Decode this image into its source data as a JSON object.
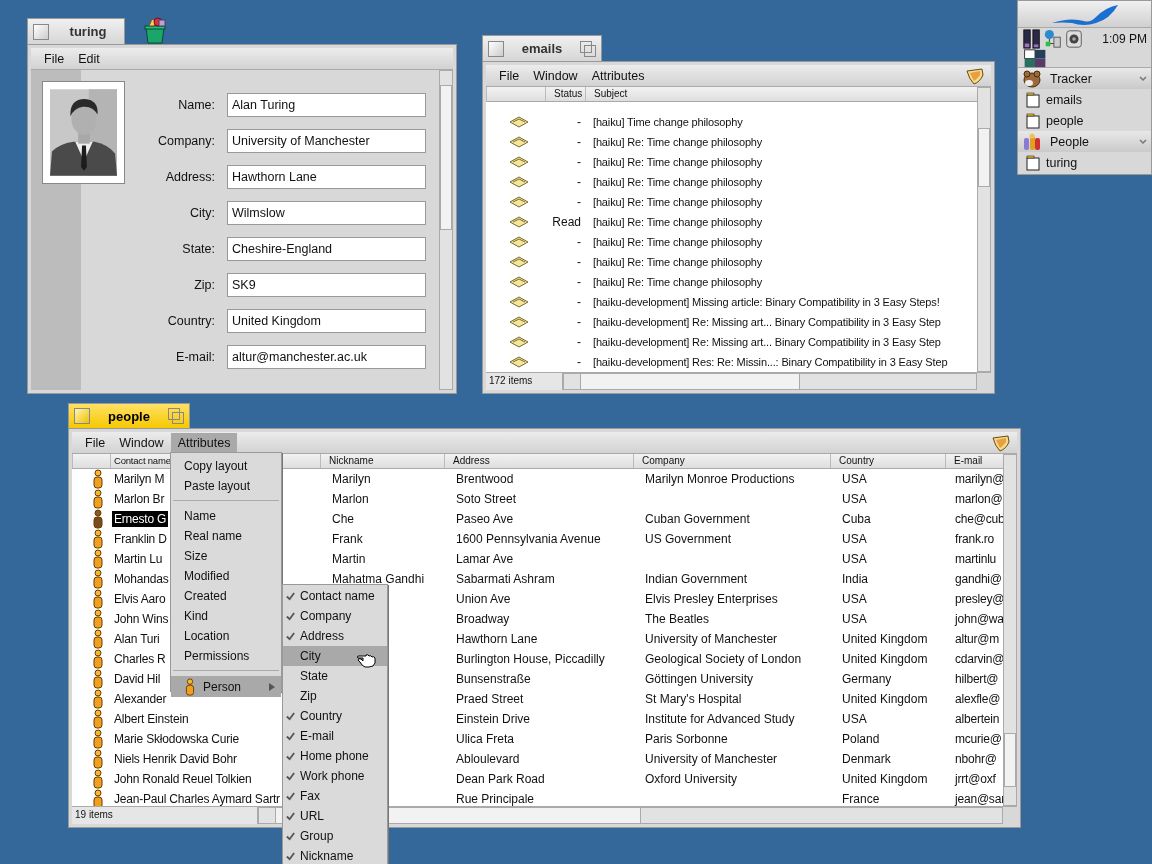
{
  "turing_window": {
    "title": "turing",
    "active": false,
    "menu": [
      "File",
      "Edit"
    ],
    "fields": [
      {
        "label": "Name:",
        "value": "Alan Turing"
      },
      {
        "label": "Company:",
        "value": "University of Manchester"
      },
      {
        "label": "Address:",
        "value": "Hawthorn Lane"
      },
      {
        "label": "City:",
        "value": "Wilmslow"
      },
      {
        "label": "State:",
        "value": "Cheshire-England"
      },
      {
        "label": "Zip:",
        "value": "SK9"
      },
      {
        "label": "Country:",
        "value": "United Kingdom"
      },
      {
        "label": "E-mail:",
        "value": "altur@manchester.ac.uk"
      }
    ]
  },
  "emails_window": {
    "title": "emails",
    "active": false,
    "menu": [
      "File",
      "Window",
      "Attributes"
    ],
    "columns": [
      "Status",
      "Subject"
    ],
    "rows": [
      {
        "status": "-",
        "subject": "[haiku] Time change philosophy"
      },
      {
        "status": "-",
        "subject": "[haiku] Re: Time change philosophy"
      },
      {
        "status": "-",
        "subject": "[haiku] Re: Time change philosophy"
      },
      {
        "status": "-",
        "subject": "[haiku] Re: Time change philosophy"
      },
      {
        "status": "-",
        "subject": "[haiku] Re: Time change philosophy"
      },
      {
        "status": "Read",
        "subject": "[haiku] Re: Time change philosophy"
      },
      {
        "status": "-",
        "subject": "[haiku] Re: Time change philosophy"
      },
      {
        "status": "-",
        "subject": "[haiku] Re: Time change philosophy"
      },
      {
        "status": "-",
        "subject": "[haiku] Re: Time change philosophy"
      },
      {
        "status": "-",
        "subject": "[haiku-development] Missing article: Binary Compatibility in 3 Easy Steps!"
      },
      {
        "status": "-",
        "subject": "[haiku-development] Re: Missing art... Binary Compatibility in 3 Easy Step"
      },
      {
        "status": "-",
        "subject": "[haiku-development] Re: Missing art... Binary Compatibility in 3 Easy Step"
      },
      {
        "status": "-",
        "subject": "[haiku-development] Res: Re: Missin...: Binary Compatibility in 3 Easy Step"
      }
    ],
    "status": "172 items"
  },
  "people_window": {
    "title": "people",
    "active": true,
    "menu": [
      {
        "label": "File",
        "selected": false
      },
      {
        "label": "Window",
        "selected": false
      },
      {
        "label": "Attributes",
        "selected": true
      }
    ],
    "columns": [
      "Contact name",
      "Nickname",
      "Address",
      "Company",
      "Country",
      "E-mail"
    ],
    "rows": [
      {
        "name": "Marilyn M",
        "nickname": "Marilyn",
        "address": "Brentwood",
        "company": "Marilyn Monroe Productions",
        "country": "USA",
        "email": "marilyn@",
        "selected": false
      },
      {
        "name": "Marlon Br",
        "nickname": "Marlon",
        "address": "Soto Street",
        "country": "USA",
        "email": "marlon@",
        "selected": false
      },
      {
        "name": "Ernesto G",
        "nickname": "Che",
        "address": "Paseo Ave",
        "company": "Cuban Government",
        "country": "Cuba",
        "email": "che@cub",
        "selected": true
      },
      {
        "name": "Franklin D",
        "nickname": "Frank",
        "address": "1600 Pennsylvania Avenue",
        "company": "US Government",
        "country": "USA",
        "email": "frank.ro",
        "selected": false
      },
      {
        "name": "Martin Lu",
        "nickname": "Martin",
        "address": "Lamar Ave",
        "country": "USA",
        "email": "martinlu",
        "selected": false
      },
      {
        "name": "Mohandas",
        "nickname": "Mahatma Gandhi",
        "address": "Sabarmati Ashram",
        "company": "Indian Government",
        "country": "India",
        "email": "gandhi@",
        "selected": false
      },
      {
        "name": "Elvis Aaro",
        "address": "Union Ave",
        "company": "Elvis Presley Enterprises",
        "country": "USA",
        "email": "presley@",
        "selected": false
      },
      {
        "name": "John Wins",
        "address": "Broadway",
        "company": "The Beatles",
        "country": "USA",
        "email": "john@wa",
        "selected": false
      },
      {
        "name": "Alan Turi",
        "address": "Hawthorn Lane",
        "company": "University of Manchester",
        "country": "United Kingdom",
        "email": "altur@m",
        "selected": false
      },
      {
        "name": "Charles R",
        "address": "Burlington House, Piccadilly",
        "company": "Geological Society of London",
        "country": "United Kingdom",
        "email": "cdarvin@",
        "selected": false
      },
      {
        "name": "David Hil",
        "address": "Bunsenstraße",
        "company": "Göttingen University",
        "country": "Germany",
        "email": "hilbert@",
        "selected": false
      },
      {
        "name": "Alexander",
        "address": "Praed Street",
        "company": "St Mary's Hospital",
        "country": "United Kingdom",
        "email": "alexfle@",
        "selected": false
      },
      {
        "name": "Albert Einstein",
        "address": "Einstein Drive",
        "company": "Institute for Advanced Study",
        "country": "USA",
        "email": "albertein",
        "selected": false
      },
      {
        "name": "Marie Skłodowska Curie",
        "address": "Ulica Freta",
        "company": "Paris Sorbonne",
        "country": "Poland",
        "email": "mcurie@",
        "selected": false
      },
      {
        "name": "Niels Henrik David Bohr",
        "address": "Abloulevard",
        "company": "University of Manchester",
        "country": "Denmark",
        "email": "nbohr@",
        "selected": false
      },
      {
        "name": "John Ronald Reuel Tolkien",
        "address": "Dean Park Road",
        "company": "Oxford University",
        "country": "United Kingdom",
        "email": "jrrt@oxf",
        "selected": false
      },
      {
        "name": "Jean-Paul Charles Aymard Sartr",
        "address": "Rue Principale",
        "country": "France",
        "email": "jean@sar",
        "selected": false
      }
    ],
    "status": "19 items",
    "attributes_menu": [
      {
        "kind": "item",
        "label": "Copy layout"
      },
      {
        "kind": "item",
        "label": "Paste layout"
      },
      {
        "kind": "separator"
      },
      {
        "kind": "item",
        "label": "Name"
      },
      {
        "kind": "item",
        "label": "Real name"
      },
      {
        "kind": "item",
        "label": "Size"
      },
      {
        "kind": "item",
        "label": "Modified"
      },
      {
        "kind": "item",
        "label": "Created"
      },
      {
        "kind": "item",
        "label": "Kind"
      },
      {
        "kind": "item",
        "label": "Location"
      },
      {
        "kind": "item",
        "label": "Permissions"
      },
      {
        "kind": "separator"
      },
      {
        "kind": "submenu",
        "label": "Person",
        "selected": true
      }
    ],
    "person_submenu": [
      {
        "label": "Contact name",
        "checked": true,
        "selected": false
      },
      {
        "label": "Company",
        "checked": true,
        "selected": false
      },
      {
        "label": "Address",
        "checked": true,
        "selected": false
      },
      {
        "label": "City",
        "checked": false,
        "selected": true
      },
      {
        "label": "State",
        "checked": false,
        "selected": false
      },
      {
        "label": "Zip",
        "checked": false,
        "selected": false
      },
      {
        "label": "Country",
        "checked": true,
        "selected": false
      },
      {
        "label": "E-mail",
        "checked": true,
        "selected": false
      },
      {
        "label": "Home phone",
        "checked": true,
        "selected": false
      },
      {
        "label": "Work phone",
        "checked": true,
        "selected": false
      },
      {
        "label": "Fax",
        "checked": true,
        "selected": false
      },
      {
        "label": "URL",
        "checked": true,
        "selected": false
      },
      {
        "label": "Group",
        "checked": true,
        "selected": false
      },
      {
        "label": "Nickname",
        "checked": true,
        "selected": false
      }
    ]
  },
  "deskbar": {
    "clock": "1:09 PM",
    "apps": [
      {
        "name": "Tracker",
        "windows": [
          "emails",
          "people"
        ]
      },
      {
        "name": "People",
        "windows": [
          "turing"
        ]
      }
    ]
  }
}
